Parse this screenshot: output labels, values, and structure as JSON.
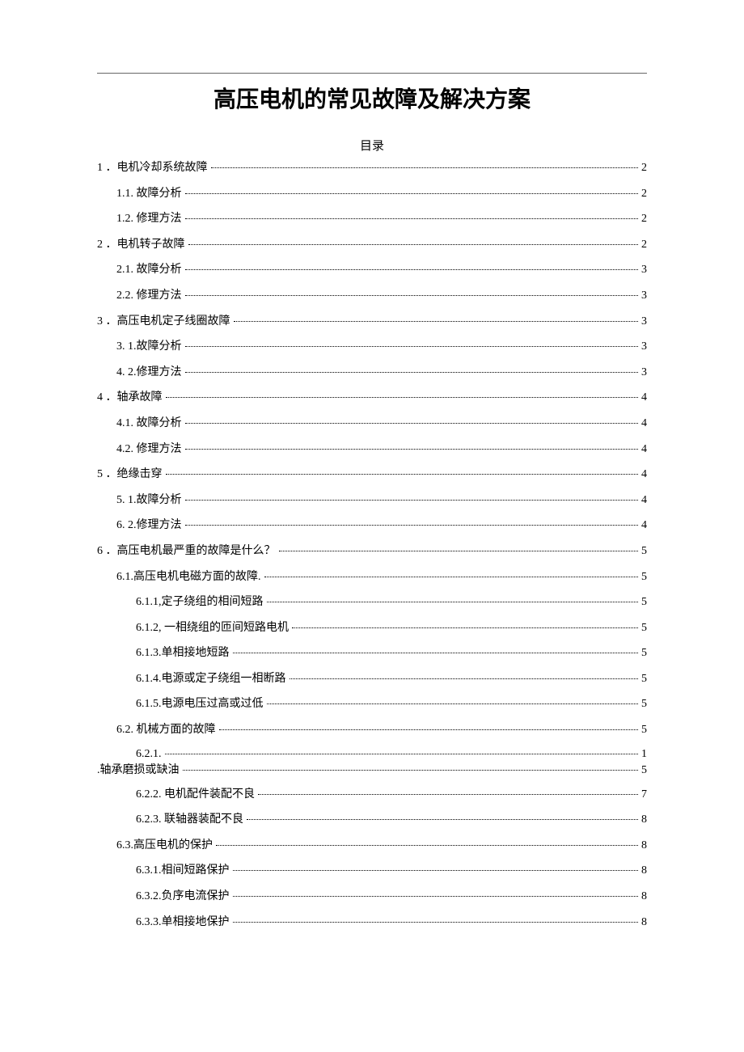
{
  "title": "高压电机的常见故障及解决方案",
  "toc_header": "目录",
  "entries": [
    {
      "indent": 0,
      "label": "1 ．电机冷却系统故障",
      "page": "2"
    },
    {
      "indent": 1,
      "label": "1.1.  故障分析",
      "page": "2"
    },
    {
      "indent": 1,
      "label": "1.2.  修理方法",
      "page": "2"
    },
    {
      "indent": 0,
      "label": "2 ．电机转子故障",
      "page": "2"
    },
    {
      "indent": 1,
      "label": "2.1.  故障分析",
      "page": "3"
    },
    {
      "indent": 1,
      "label": "2.2.  修理方法",
      "page": "3"
    },
    {
      "indent": 0,
      "label": "3 ．高压电机定子线圈故障",
      "page": "3"
    },
    {
      "indent": 1,
      "label": "3. 1.故障分析",
      "page": "3"
    },
    {
      "indent": 1,
      "label": "4. 2.修理方法",
      "page": "3"
    },
    {
      "indent": 0,
      "label": "4 ．轴承故障",
      "page": "4"
    },
    {
      "indent": 1,
      "label": "4.1.  故障分析",
      "page": "4"
    },
    {
      "indent": 1,
      "label": "4.2.  修理方法",
      "page": "4"
    },
    {
      "indent": 0,
      "label": "5 ．绝缘击穿",
      "page": "4"
    },
    {
      "indent": 1,
      "label": "5. 1.故障分析",
      "page": "4"
    },
    {
      "indent": 1,
      "label": "6. 2.修理方法",
      "page": "4"
    },
    {
      "indent": 0,
      "label": "6 ．高压电机最严重的故障是什么？",
      "page": "5"
    },
    {
      "indent": 1,
      "label": "6.1.高压电机电磁方面的故障.",
      "page": "5"
    },
    {
      "indent": 2,
      "label": "6.1.1,定子绕组的相间短路",
      "page": "5"
    },
    {
      "indent": 2,
      "label": "6.1.2,  一相绕组的匝间短路电机",
      "page": "5"
    },
    {
      "indent": 2,
      "label": "6.1.3.单相接地短路",
      "page": "5"
    },
    {
      "indent": 2,
      "label": "6.1.4.电源或定子绕组一相断路",
      "page": "5"
    },
    {
      "indent": 2,
      "label": "6.1.5.电源电压过高或过低",
      "page": "5"
    },
    {
      "indent": 1,
      "label": "6.2.  机械方面的故障",
      "page": "5"
    },
    {
      "indent": -1,
      "type": "wrap",
      "line1_label": "6.2.1.",
      "line1_page": "1",
      "line2_label": ".轴承磨损或缺油",
      "line2_page": "5"
    },
    {
      "indent": 2,
      "label": "6.2.2.  电机配件装配不良",
      "page": "7"
    },
    {
      "indent": 2,
      "label": "6.2.3.  联轴器装配不良",
      "page": "8"
    },
    {
      "indent": 1,
      "label": "6.3.高压电机的保护",
      "page": "8"
    },
    {
      "indent": 2,
      "label": "6.3.1.相间短路保护",
      "page": "8"
    },
    {
      "indent": 2,
      "label": "6.3.2.负序电流保护",
      "page": "8"
    },
    {
      "indent": 2,
      "label": "6.3.3.单相接地保护",
      "page": "8"
    }
  ]
}
